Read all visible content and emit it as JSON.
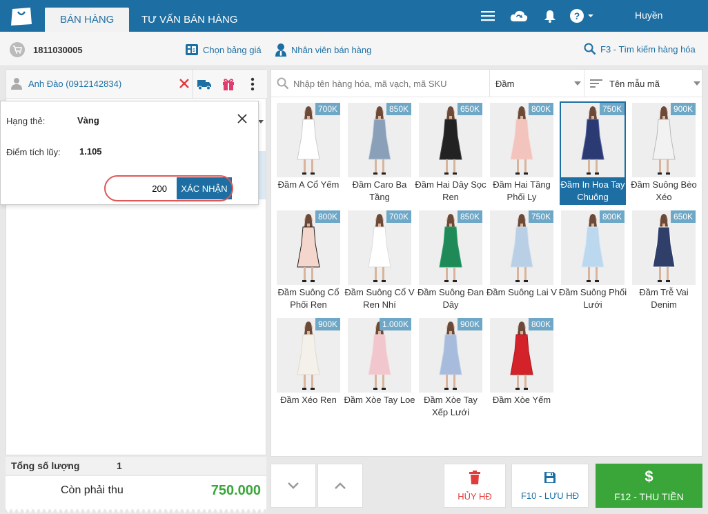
{
  "header": {
    "tabs": [
      {
        "label": "BÁN HÀNG",
        "active": true
      },
      {
        "label": "TƯ VẤN BÁN HÀNG",
        "active": false
      }
    ],
    "user": "Huyền",
    "icons": [
      "menu-icon",
      "cloud-sync-icon",
      "bell-icon",
      "help-icon"
    ]
  },
  "subbar": {
    "order_number": "1811030005",
    "price_list": "Chọn bảng giá",
    "salesperson": "Nhân viên bán hàng",
    "search_shortcut": "F3 - Tìm kiếm hàng hóa"
  },
  "customer": {
    "name": "Anh Đào (0912142834)"
  },
  "popup": {
    "tier_label": "Hạng thẻ:",
    "tier_value": "Vàng",
    "points_label": "Điểm tích lũy:",
    "points_value": "1.105",
    "input_value": "200",
    "confirm_label": "XÁC NHẬN"
  },
  "totals": {
    "qty_label": "Tổng số lượng",
    "qty_value": "1",
    "due_label": "Còn phải thu",
    "due_value": "750.000"
  },
  "search": {
    "placeholder": "Nhập tên hàng hóa, mã vạch, mã SKU",
    "category": "Đầm",
    "sort": "Tên mẫu mã"
  },
  "products": [
    {
      "name": "Đầm A Cổ Yếm",
      "price": "700K",
      "dress": "#ffffff",
      "accent": "#cccccc"
    },
    {
      "name": "Đầm Caro Ba Tầng",
      "price": "850K",
      "dress": "#8aa0b8",
      "accent": "#d0d8e0"
    },
    {
      "name": "Đầm Hai Dây Sọc Ren",
      "price": "650K",
      "dress": "#222222",
      "accent": "#444444"
    },
    {
      "name": "Đầm Hai Tầng Phối Ly",
      "price": "800K",
      "dress": "#f3c3bd",
      "accent": "#f7d8d3"
    },
    {
      "name": "Đầm In Hoa Tay Chuông",
      "price": "750K",
      "dress": "#2c3a73",
      "accent": "#5a6aa8",
      "selected": true
    },
    {
      "name": "Đầm Suông Bèo Xéo",
      "price": "900K",
      "dress": "#f2f2f2",
      "accent": "#b9b9b9"
    },
    {
      "name": "Đầm Suông Cổ Phối Ren",
      "price": "800K",
      "dress": "#f5d6cc",
      "accent": "#222222"
    },
    {
      "name": "Đầm Suông Cổ V Ren Nhí",
      "price": "700K",
      "dress": "#ffffff",
      "accent": "#dddddd"
    },
    {
      "name": "Đầm Suông Đan Dây",
      "price": "850K",
      "dress": "#1f8a57",
      "accent": "#2aa06a"
    },
    {
      "name": "Đầm Suông Lai V",
      "price": "750K",
      "dress": "#b9cfe6",
      "accent": "#d2e0ef"
    },
    {
      "name": "Đầm Suông Phối Lưới",
      "price": "800K",
      "dress": "#bcd8ee",
      "accent": "#d8e8f4"
    },
    {
      "name": "Đầm Trễ Vai Denim",
      "price": "650K",
      "dress": "#2f3f6a",
      "accent": "#ffffff"
    },
    {
      "name": "Đầm Xéo Ren",
      "price": "900K",
      "dress": "#f4f0ea",
      "accent": "#e0dad0"
    },
    {
      "name": "Đầm Xòe Tay Loe",
      "price": "1.000K",
      "dress": "#f1c6cc",
      "accent": "#f6dadf"
    },
    {
      "name": "Đầm Xòe Tay Xếp Lưới",
      "price": "900K",
      "dress": "#a7bcdc",
      "accent": "#c3d2e8"
    },
    {
      "name": "Đầm Xòe Yếm",
      "price": "800K",
      "dress": "#d3222a",
      "accent": "#b0161e"
    }
  ],
  "actions": {
    "cancel": "HỦY HĐ",
    "save": "F10 - LƯU HĐ",
    "pay": "F12 - THU TIỀN"
  },
  "colors": {
    "primary": "#1d6fa3",
    "pay_green": "#3aa63a",
    "danger": "#e03c3c",
    "price_tag": "#6fa7c6"
  }
}
